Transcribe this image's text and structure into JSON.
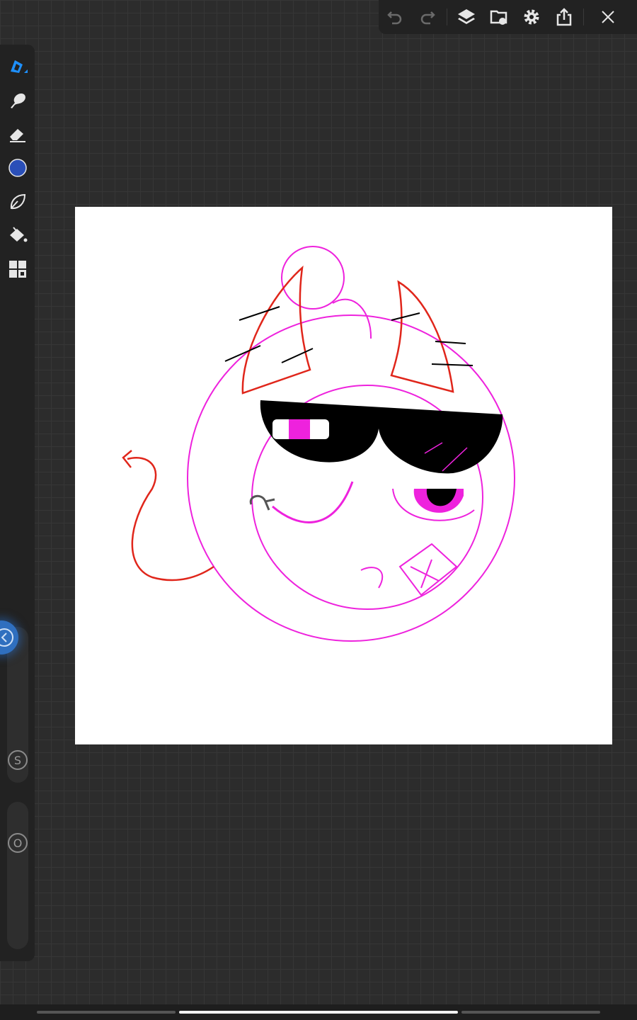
{
  "toolbar": {
    "icons": [
      "undo-icon",
      "redo-icon",
      "layers-icon",
      "gallery-icon",
      "settings-icon",
      "share-icon",
      "close-icon"
    ]
  },
  "tools": {
    "icons": [
      "pen-icon",
      "smudge-icon",
      "eraser-icon",
      "color-icon",
      "leaf-brush-icon",
      "fill-bucket-icon",
      "grid-icon"
    ],
    "active_color": "#2a4fb8",
    "accent": "#1e90ff"
  },
  "sliders": {
    "size_label": "S",
    "opacity_label": "O"
  },
  "drawing": {
    "pink": "#ee22dd",
    "red": "#e0261b"
  }
}
